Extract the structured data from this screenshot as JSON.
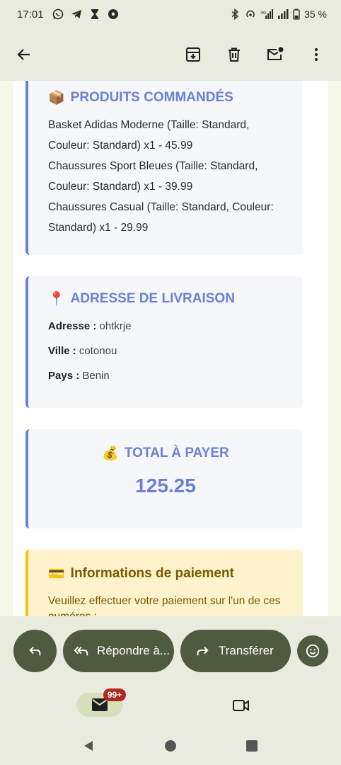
{
  "status_bar": {
    "time": "17:01",
    "battery": "35 %",
    "left_icons": [
      "whatsapp-icon",
      "telegram-icon",
      "hourglass-icon",
      "soccer-icon"
    ],
    "right_icons": [
      "bluetooth-icon",
      "hotspot-icon",
      "signal-4g-icon",
      "signal-icon",
      "battery-icon"
    ]
  },
  "app_bar": {
    "back_icon": "arrow-back-icon",
    "actions": [
      "archive-icon",
      "delete-icon",
      "mark-unread-icon",
      "more-vert-icon"
    ]
  },
  "email": {
    "products": {
      "emoji": "📦",
      "title": "PRODUITS COMMANDÉS",
      "items": [
        "Basket Adidas Moderne (Taille: Standard, Couleur: Standard) x1 - 45.99",
        "Chaussures Sport Bleues (Taille: Standard, Couleur: Standard) x1 - 39.99",
        "Chaussures Casual (Taille: Standard, Couleur: Standard) x1 - 29.99"
      ]
    },
    "address": {
      "emoji": "📍",
      "title": "ADRESSE DE LIVRAISON",
      "rows": [
        {
          "label": "Adresse :",
          "value": "ohtkrje"
        },
        {
          "label": "Ville :",
          "value": "cotonou"
        },
        {
          "label": "Pays :",
          "value": "Benin"
        }
      ]
    },
    "total": {
      "emoji": "💰",
      "title": "TOTAL À PAYER",
      "value": "125.25"
    },
    "payment": {
      "emoji": "💳",
      "title": "Informations de paiement",
      "text": "Veuillez effectuer votre paiement sur l'un de ces numéros :"
    }
  },
  "actions": {
    "reply_icon": "reply-icon",
    "reply_all_label": "Répondre à...",
    "forward_label": "Transférer",
    "emoji_icon": "emoji-icon"
  },
  "bottom_nav": {
    "mail_badge": "99+"
  },
  "colors": {
    "accent": "#6b80d8",
    "pill": "#4f5a3f",
    "bar_bg": "#e9ebdf",
    "badge": "#b3261e",
    "payment_bg": "#fff3cd",
    "payment_text": "#7a5a00"
  }
}
